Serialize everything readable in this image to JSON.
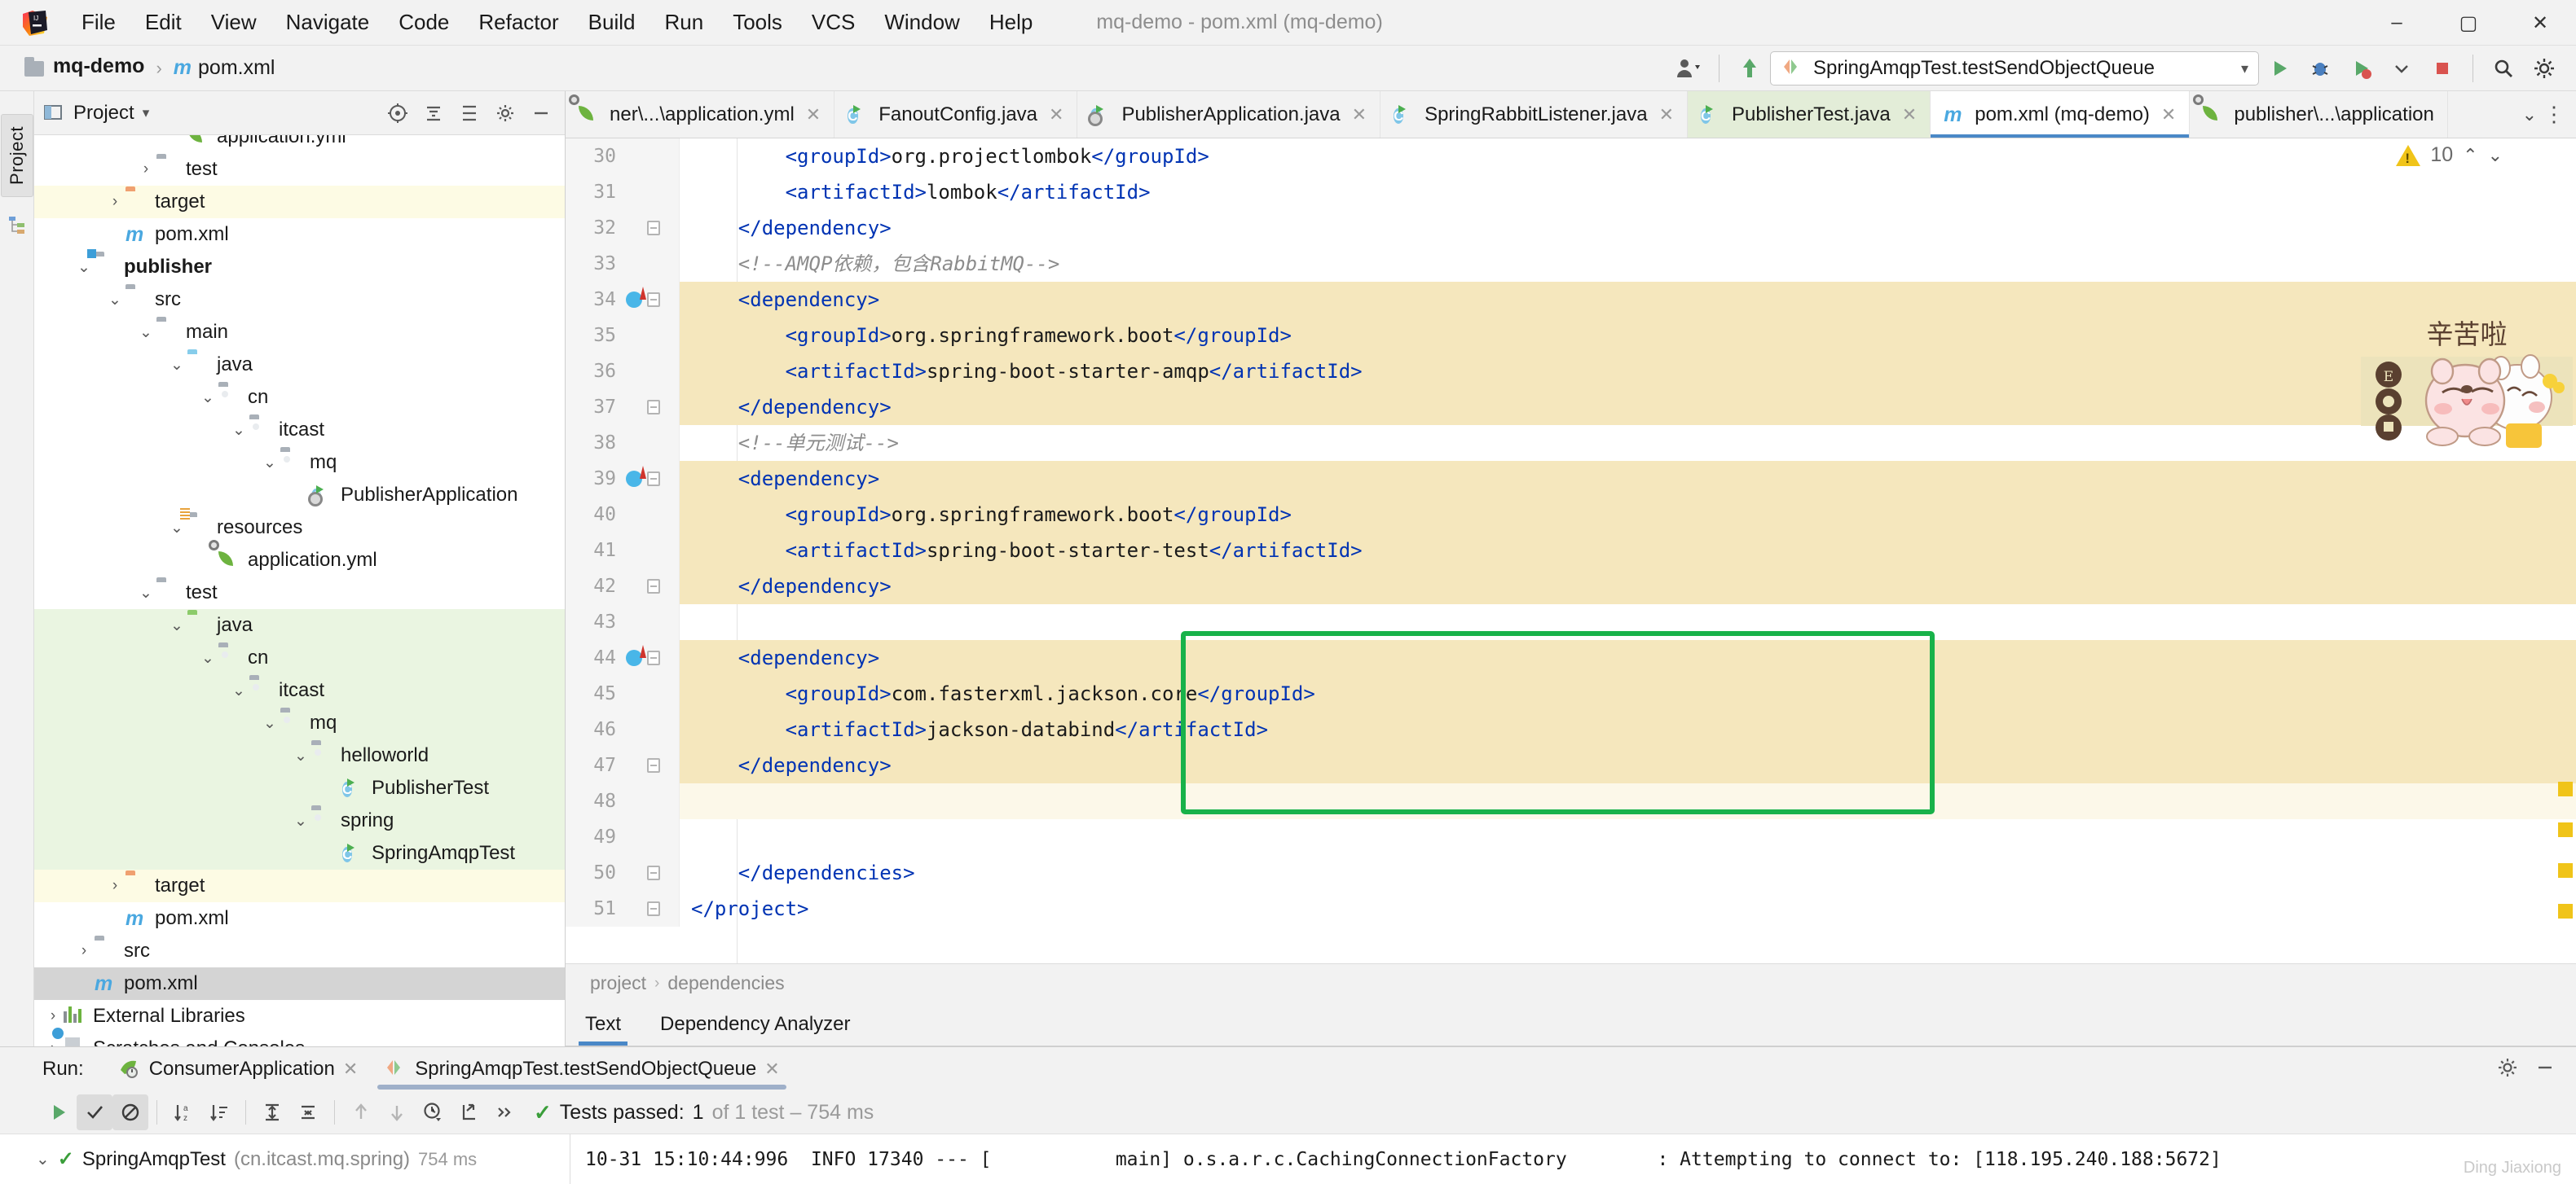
{
  "window": {
    "title": "mq-demo - pom.xml (mq-demo)",
    "minimize": "–",
    "maximize": "▢",
    "close": "✕"
  },
  "menu": [
    {
      "label": "File"
    },
    {
      "label": "Edit"
    },
    {
      "label": "View"
    },
    {
      "label": "Navigate"
    },
    {
      "label": "Code"
    },
    {
      "label": "Refactor"
    },
    {
      "label": "Build"
    },
    {
      "label": "Run"
    },
    {
      "label": "Tools"
    },
    {
      "label": "VCS"
    },
    {
      "label": "Window"
    },
    {
      "label": "Help"
    }
  ],
  "navbar": {
    "crumbs": [
      {
        "label": "mq-demo",
        "icon": "project-icon"
      },
      {
        "label": "pom.xml",
        "icon": "maven-file-icon"
      }
    ],
    "run_config": "SpringAmqpTest.testSendObjectQueue",
    "run_config_caret": "▾",
    "buttons": [
      {
        "name": "user-avatar-button",
        "glyph": "👤"
      },
      {
        "name": "update-project-button",
        "glyph": "↖"
      },
      {
        "name": "run-button",
        "glyph": "▶"
      },
      {
        "name": "debug-button",
        "glyph": "🐞"
      },
      {
        "name": "run-with-coverage-button",
        "glyph": "▶"
      },
      {
        "name": "more-run-options-button",
        "glyph": "▾"
      },
      {
        "name": "stop-button",
        "glyph": "■"
      },
      {
        "name": "search-everywhere-button",
        "glyph": "🔍"
      },
      {
        "name": "settings-button",
        "glyph": "⚙"
      }
    ]
  },
  "left_strip": {
    "project_tab": "Project",
    "structure_tab": "Structure"
  },
  "project_panel": {
    "title": "Project",
    "caret": "▾",
    "actions": [
      "target-icon",
      "collapse-all-icon",
      "expand-icon",
      "settings-icon",
      "hide-icon"
    ],
    "tree": [
      {
        "depth": 4,
        "arrow": "",
        "icon": "spring-yml-icon",
        "label": "application.yml",
        "state": "partial"
      },
      {
        "depth": 3,
        "arrow": "›",
        "icon": "folder-grey",
        "label": "test",
        "state": "normal"
      },
      {
        "depth": 2,
        "arrow": "›",
        "icon": "folder-orange",
        "label": "target",
        "state": "yellow"
      },
      {
        "depth": 2,
        "arrow": "",
        "icon": "maven-file-icon",
        "label": "pom.xml",
        "state": "normal"
      },
      {
        "depth": 1,
        "arrow": "⌄",
        "icon": "module-icon",
        "label": "publisher",
        "state": "normal",
        "bold": true
      },
      {
        "depth": 2,
        "arrow": "⌄",
        "icon": "folder-grey",
        "label": "src",
        "state": "normal"
      },
      {
        "depth": 3,
        "arrow": "⌄",
        "icon": "folder-grey",
        "label": "main",
        "state": "normal"
      },
      {
        "depth": 4,
        "arrow": "⌄",
        "icon": "folder-blue",
        "label": "java",
        "state": "normal"
      },
      {
        "depth": 5,
        "arrow": "⌄",
        "icon": "package-icon",
        "label": "cn",
        "state": "normal"
      },
      {
        "depth": 6,
        "arrow": "⌄",
        "icon": "package-icon",
        "label": "itcast",
        "state": "normal"
      },
      {
        "depth": 7,
        "arrow": "⌄",
        "icon": "package-icon",
        "label": "mq",
        "state": "normal"
      },
      {
        "depth": 8,
        "arrow": "",
        "icon": "spring-class-icon",
        "label": "PublisherApplication",
        "state": "normal"
      },
      {
        "depth": 4,
        "arrow": "⌄",
        "icon": "folder-resources",
        "label": "resources",
        "state": "normal"
      },
      {
        "depth": 5,
        "arrow": "",
        "icon": "spring-yml-icon",
        "label": "application.yml",
        "state": "normal"
      },
      {
        "depth": 3,
        "arrow": "⌄",
        "icon": "folder-grey",
        "label": "test",
        "state": "normal"
      },
      {
        "depth": 4,
        "arrow": "⌄",
        "icon": "folder-green",
        "label": "java",
        "state": "green"
      },
      {
        "depth": 5,
        "arrow": "⌄",
        "icon": "package-icon",
        "label": "cn",
        "state": "green"
      },
      {
        "depth": 6,
        "arrow": "⌄",
        "icon": "package-icon",
        "label": "itcast",
        "state": "green"
      },
      {
        "depth": 7,
        "arrow": "⌄",
        "icon": "package-icon",
        "label": "mq",
        "state": "green"
      },
      {
        "depth": 8,
        "arrow": "⌄",
        "icon": "package-icon",
        "label": "helloworld",
        "state": "green"
      },
      {
        "depth": 9,
        "arrow": "",
        "icon": "java-class-icon",
        "label": "PublisherTest",
        "state": "green"
      },
      {
        "depth": 8,
        "arrow": "⌄",
        "icon": "package-icon",
        "label": "spring",
        "state": "green"
      },
      {
        "depth": 9,
        "arrow": "",
        "icon": "java-class-icon",
        "label": "SpringAmqpTest",
        "state": "green"
      },
      {
        "depth": 2,
        "arrow": "›",
        "icon": "folder-orange",
        "label": "target",
        "state": "yellow"
      },
      {
        "depth": 2,
        "arrow": "",
        "icon": "maven-file-icon",
        "label": "pom.xml",
        "state": "normal"
      },
      {
        "depth": 1,
        "arrow": "›",
        "icon": "folder-grey",
        "label": "src",
        "state": "normal"
      },
      {
        "depth": 1,
        "arrow": "",
        "icon": "maven-file-icon",
        "label": "pom.xml",
        "state": "selected"
      },
      {
        "depth": 0,
        "arrow": "›",
        "icon": "libraries-icon",
        "label": "External Libraries",
        "state": "normal"
      },
      {
        "depth": 0,
        "arrow": "›",
        "icon": "scratches-icon",
        "label": "Scratches and Consoles",
        "state": "normal"
      }
    ]
  },
  "editor_tabs": [
    {
      "label": "ner\\...\\application.yml",
      "icon": "spring-yml-icon",
      "state": "normal",
      "close": "✕"
    },
    {
      "label": "FanoutConfig.java",
      "icon": "java-class-icon",
      "state": "normal",
      "close": "✕"
    },
    {
      "label": "PublisherApplication.java",
      "icon": "spring-class-icon",
      "state": "normal",
      "close": "✕"
    },
    {
      "label": "SpringRabbitListener.java",
      "icon": "java-class-icon",
      "state": "normal",
      "close": "✕"
    },
    {
      "label": "PublisherTest.java",
      "icon": "java-class-icon",
      "state": "green",
      "close": "✕"
    },
    {
      "label": "pom.xml (mq-demo)",
      "icon": "maven-file-icon",
      "state": "active",
      "close": "✕"
    },
    {
      "label": "publisher\\...\\application",
      "icon": "spring-yml-icon",
      "state": "normal",
      "close": ""
    }
  ],
  "editor_tabs_overflow": {
    "chevron": "⌄",
    "more": "⋮"
  },
  "inspection": {
    "warning_glyph": "⚠",
    "count": "10",
    "prev": "⌃",
    "next": "⌄"
  },
  "code": {
    "first_line_number": 30,
    "lines": [
      {
        "n": 30,
        "hl": "none",
        "indent": 8,
        "parts": [
          {
            "t": "tag",
            "v": "<groupId>"
          },
          {
            "t": "txt",
            "v": "org.projectlombok"
          },
          {
            "t": "tag",
            "v": "</groupId>"
          }
        ]
      },
      {
        "n": 31,
        "hl": "none",
        "indent": 8,
        "parts": [
          {
            "t": "tag",
            "v": "<artifactId>"
          },
          {
            "t": "txt",
            "v": "lombok"
          },
          {
            "t": "tag",
            "v": "</artifactId>"
          }
        ]
      },
      {
        "n": 32,
        "hl": "none",
        "indent": 4,
        "parts": [
          {
            "t": "tag",
            "v": "</dependency>"
          }
        ],
        "fold": true
      },
      {
        "n": 33,
        "hl": "none",
        "indent": 4,
        "parts": [
          {
            "t": "cmt",
            "v": "<!--AMQP依赖，包含RabbitMQ-->"
          }
        ]
      },
      {
        "n": 34,
        "hl": "full",
        "indent": 4,
        "parts": [
          {
            "t": "tag",
            "v": "<dependency>"
          }
        ],
        "fold": true,
        "run": true
      },
      {
        "n": 35,
        "hl": "full",
        "indent": 8,
        "parts": [
          {
            "t": "tag",
            "v": "<groupId>"
          },
          {
            "t": "txt",
            "v": "org.springframework.boot"
          },
          {
            "t": "tag",
            "v": "</groupId>"
          }
        ]
      },
      {
        "n": 36,
        "hl": "full",
        "indent": 8,
        "parts": [
          {
            "t": "tag",
            "v": "<artifactId>"
          },
          {
            "t": "txt",
            "v": "spring-boot-starter-amqp"
          },
          {
            "t": "tag",
            "v": "</artifactId>"
          }
        ]
      },
      {
        "n": 37,
        "hl": "full",
        "indent": 4,
        "parts": [
          {
            "t": "tag",
            "v": "</dependency>"
          }
        ],
        "fold": true
      },
      {
        "n": 38,
        "hl": "none",
        "indent": 4,
        "parts": [
          {
            "t": "cmt",
            "v": "<!--单元测试-->"
          }
        ]
      },
      {
        "n": 39,
        "hl": "full",
        "indent": 4,
        "parts": [
          {
            "t": "tag",
            "v": "<dependency>"
          }
        ],
        "fold": true,
        "run": true
      },
      {
        "n": 40,
        "hl": "full",
        "indent": 8,
        "parts": [
          {
            "t": "tag",
            "v": "<groupId>"
          },
          {
            "t": "txt",
            "v": "org.springframework.boot"
          },
          {
            "t": "tag",
            "v": "</groupId>"
          }
        ]
      },
      {
        "n": 41,
        "hl": "full",
        "indent": 8,
        "parts": [
          {
            "t": "tag",
            "v": "<artifactId>"
          },
          {
            "t": "txt",
            "v": "spring-boot-starter-test"
          },
          {
            "t": "tag",
            "v": "</artifactId>"
          }
        ]
      },
      {
        "n": 42,
        "hl": "full",
        "indent": 4,
        "parts": [
          {
            "t": "tag",
            "v": "</dependency>"
          }
        ],
        "fold": true
      },
      {
        "n": 43,
        "hl": "none",
        "indent": 0,
        "parts": []
      },
      {
        "n": 44,
        "hl": "full",
        "indent": 4,
        "parts": [
          {
            "t": "tag",
            "v": "<dependency>"
          }
        ],
        "fold": true,
        "run": true
      },
      {
        "n": 45,
        "hl": "full",
        "indent": 8,
        "parts": [
          {
            "t": "tag",
            "v": "<groupId>"
          },
          {
            "t": "txt",
            "v": "com.fasterxml.jackson.core"
          },
          {
            "t": "tag",
            "v": "</groupId>"
          }
        ]
      },
      {
        "n": 46,
        "hl": "full",
        "indent": 8,
        "parts": [
          {
            "t": "tag",
            "v": "<artifactId>"
          },
          {
            "t": "txt",
            "v": "jackson-databind"
          },
          {
            "t": "tag",
            "v": "</artifactId>"
          }
        ]
      },
      {
        "n": 47,
        "hl": "full",
        "indent": 4,
        "parts": [
          {
            "t": "tag",
            "v": "</dependency>"
          }
        ],
        "fold": true
      },
      {
        "n": 48,
        "hl": "soft",
        "indent": 0,
        "parts": []
      },
      {
        "n": 49,
        "hl": "none",
        "indent": 0,
        "parts": []
      },
      {
        "n": 50,
        "hl": "none",
        "indent": 4,
        "parts": [
          {
            "t": "tag",
            "v": "</dependencies>"
          }
        ],
        "fold": true
      },
      {
        "n": 51,
        "hl": "none",
        "indent": 0,
        "parts": [
          {
            "t": "tag",
            "v": "</project>"
          }
        ],
        "fold": true
      }
    ]
  },
  "annotation": {
    "box_color": "#18b24a"
  },
  "sticker": {
    "caption": "辛苦啦"
  },
  "breadcrumb": {
    "items": [
      "project",
      "dependencies"
    ],
    "sep": "›"
  },
  "editor_subtabs": [
    {
      "label": "Text",
      "active": true
    },
    {
      "label": "Dependency Analyzer",
      "active": false
    }
  ],
  "run_panel": {
    "label": "Run:",
    "tabs": [
      {
        "label": "ConsumerApplication",
        "icon": "spring-boot-icon",
        "active": false,
        "close": "✕"
      },
      {
        "label": "SpringAmqpTest.testSendObjectQueue",
        "icon": "test-icon",
        "active": true,
        "close": "✕"
      }
    ],
    "right_buttons": [
      {
        "name": "run-panel-settings-button",
        "glyph": "⚙"
      },
      {
        "name": "run-panel-hide-button",
        "glyph": "—"
      }
    ],
    "toolbar": [
      {
        "name": "rerun-tests-button",
        "glyph": "▶",
        "state": "green"
      },
      {
        "name": "show-passed-toggle",
        "glyph": "✓",
        "state": "on"
      },
      {
        "name": "show-ignored-toggle",
        "glyph": "⊘",
        "state": "on"
      },
      {
        "name": "sort-alphabetically-button",
        "glyph": "↓a\\nz",
        "state": "normal"
      },
      {
        "name": "sort-by-duration-button",
        "glyph": "↓≡",
        "state": "normal"
      },
      {
        "name": "expand-all-button",
        "glyph": "⤒",
        "state": "normal"
      },
      {
        "name": "collapse-all-button",
        "glyph": "⤓",
        "state": "normal"
      },
      {
        "name": "previous-failed-test-button",
        "glyph": "↑",
        "state": "dim"
      },
      {
        "name": "next-failed-test-button",
        "glyph": "↓",
        "state": "dim"
      },
      {
        "name": "test-history-button",
        "glyph": "◔",
        "state": "normal"
      },
      {
        "name": "export-test-results-button",
        "glyph": "⇱",
        "state": "normal"
      },
      {
        "name": "more-toolbar-options-button",
        "glyph": "»",
        "state": "normal"
      }
    ],
    "status": {
      "check": "✓",
      "text": "Tests passed: ",
      "count": "1",
      "suffix": " of 1 test – 754 ms"
    },
    "tests_tree": {
      "expand": "⌄",
      "check": "✓",
      "name": "SpringAmqpTest",
      "package": "(cn.itcast.mq.spring)",
      "duration": "754 ms"
    },
    "console_line": "10-31 15:10:44:996  INFO 17340 --- [           main] o.s.a.r.c.CachingConnectionFactory        : Attempting to connect to: [118.195.240.188:5672]"
  },
  "watermark": "Ding Jiaxiong"
}
